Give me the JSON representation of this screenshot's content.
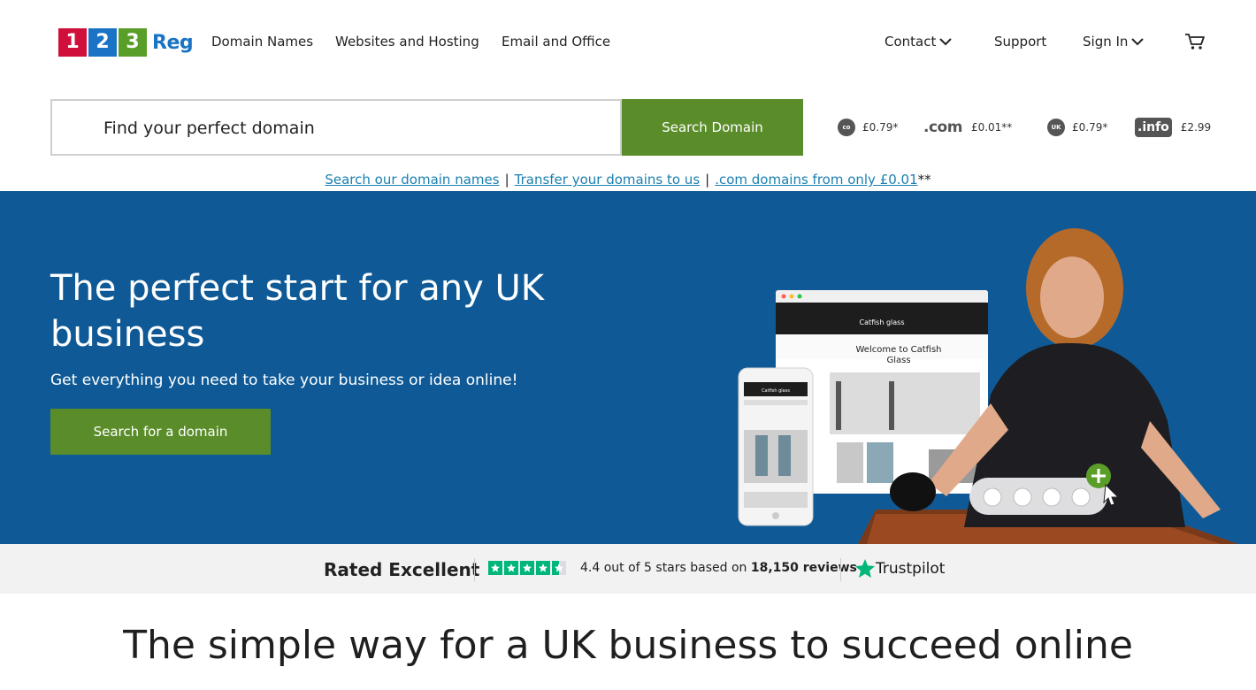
{
  "brand": {
    "logo_digits": [
      "1",
      "2",
      "3"
    ],
    "logo_text": "Reg",
    "logo_colors": [
      "#d0103a",
      "#1a73c4",
      "#5a9e2a"
    ]
  },
  "nav": {
    "primary": [
      {
        "label": "Domain Names"
      },
      {
        "label": "Websites and Hosting"
      },
      {
        "label": "Email and Office"
      }
    ],
    "contact": "Contact",
    "support": "Support",
    "sign_in": "Sign In",
    "cart_icon": "cart-icon"
  },
  "search": {
    "placeholder": "Find your perfect domain",
    "button": "Search Domain"
  },
  "tld_prices": [
    {
      "badge": "co.uk",
      "price": "£0.79*"
    },
    {
      "badge": ".com",
      "price": "£0.01**"
    },
    {
      "badge": "UK",
      "price": "£0.79*"
    },
    {
      "badge": ".info",
      "price": "£2.99"
    }
  ],
  "quick_links": {
    "link1": "Search our domain names",
    "link2": "Transfer your domains to us",
    "link3": ".com domains from only £0.01",
    "suffix": "**",
    "separator": "|"
  },
  "hero": {
    "title": "The perfect start for any UK business",
    "subtitle": "Get everything you need to take your business or idea online!",
    "cta": "Search for a domain",
    "mock_site_title": "Catfish glass",
    "mock_site_heading": "Welcome to Catfish Glass",
    "mobile_site_title": "Catfish glass"
  },
  "trust": {
    "rated": "Rated Excellent",
    "score_text": "4.4 out of 5 stars based on",
    "reviews": "18,150 reviews",
    "brand": "Trustpilot",
    "rating": 4.4,
    "star_color": "#00b67a"
  },
  "section": {
    "title": "The simple way for a UK business to succeed online"
  },
  "colors": {
    "accent_green": "#5a8d2a",
    "hero_blue": "#0f5a96",
    "link_blue": "#1a7fb0"
  }
}
